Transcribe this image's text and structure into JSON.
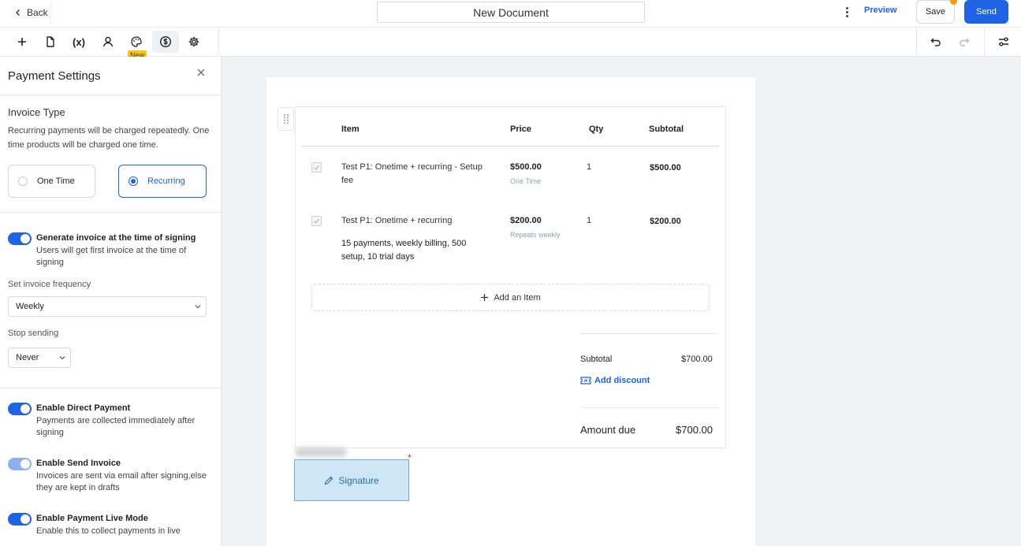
{
  "header": {
    "back_label": "Back",
    "document_title": "New Document",
    "preview_label": "Preview",
    "save_label": "Save",
    "send_label": "Send",
    "accent_color": "#1e62e6",
    "unsaved_indicator_color": "#f59e0b"
  },
  "toolbar": {
    "variables_label": "(x)",
    "new_badge": "New",
    "icons": [
      "plus-icon",
      "document-icon",
      "variables-icon",
      "user-icon",
      "palette-icon",
      "dollar-icon",
      "gear-icon",
      "undo-icon",
      "redo-icon",
      "sliders-icon"
    ]
  },
  "panel": {
    "title": "Payment Settings",
    "invoice_type": {
      "title": "Invoice Type",
      "description": "Recurring payments will be charged repeatedly. One time products will be charged one time.",
      "options": [
        "One Time",
        "Recurring"
      ],
      "selected": "Recurring"
    },
    "generate_invoice": {
      "title": "Generate invoice at the time of signing",
      "description": "Users will get first invoice at the time of signing",
      "enabled": true
    },
    "frequency": {
      "label": "Set invoice frequency",
      "value": "Weekly"
    },
    "stop_sending": {
      "label": "Stop sending",
      "value": "Never"
    },
    "direct_payment": {
      "title": "Enable Direct Payment",
      "description": "Payments are collected immediately after signing",
      "enabled": true
    },
    "send_invoice": {
      "title": "Enable Send Invoice",
      "description": "Invoices are sent via email after signing,else they are kept in drafts",
      "enabled": true
    },
    "live_mode": {
      "title": "Enable Payment Live Mode",
      "description": "Enable this to collect payments in live",
      "enabled": true
    }
  },
  "document": {
    "columns": [
      "Item",
      "Price",
      "Qty",
      "Subtotal"
    ],
    "rows": [
      {
        "item": "Test P1: Onetime + recurring - Setup fee",
        "detail": "",
        "price": "$500.00",
        "price_note": "One Time",
        "qty": "1",
        "subtotal": "$500.00",
        "checked": true
      },
      {
        "item": "Test P1: Onetime + recurring",
        "detail": "15 payments, weekly billing, 500 setup, 10 trial days",
        "price": "$200.00",
        "price_note": "Repeats weekly",
        "qty": "1",
        "subtotal": "$200.00",
        "checked": true
      }
    ],
    "add_item_label": "Add an Item",
    "subtotal_label": "Subtotal",
    "subtotal_value": "$700.00",
    "add_discount_label": "Add discount",
    "amount_due_label": "Amount due",
    "amount_due_value": "$700.00",
    "signature_label": "Signature",
    "required_marker": "*"
  }
}
